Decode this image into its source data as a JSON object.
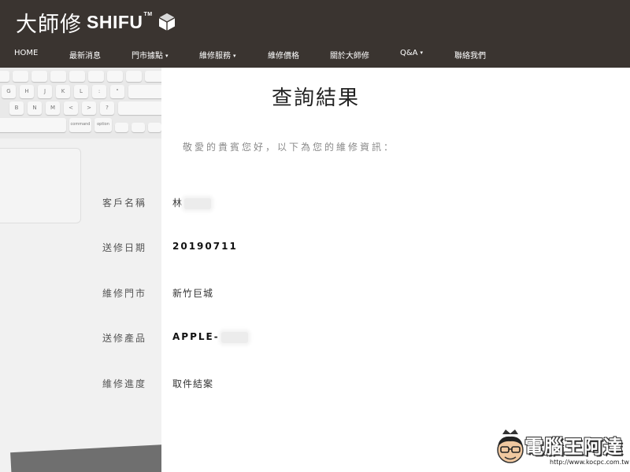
{
  "header": {
    "logo_cn": "大師修",
    "logo_en": "SHIFU",
    "logo_tm": "TM"
  },
  "nav": {
    "items": [
      {
        "label": "HOME",
        "dropdown": false
      },
      {
        "label": "最新消息",
        "dropdown": false
      },
      {
        "label": "門市據點",
        "dropdown": true
      },
      {
        "label": "維修服務",
        "dropdown": true
      },
      {
        "label": "維修價格",
        "dropdown": false
      },
      {
        "label": "關於大師修",
        "dropdown": false
      },
      {
        "label": "Q&A",
        "dropdown": true
      },
      {
        "label": "聯絡我們",
        "dropdown": false
      }
    ],
    "caret": "▾"
  },
  "keyboard": {
    "row1": [
      "G",
      "H",
      "J",
      "K",
      "L",
      ":",
      "\""
    ],
    "row2": [
      "B",
      "N",
      "M",
      "<",
      ">",
      "?"
    ],
    "row3": [
      "command",
      "option"
    ]
  },
  "main": {
    "title": "查詢結果",
    "greeting": "敬愛的貴賓您好，以下為您的維修資訊：",
    "rows": [
      {
        "label": "客戶名稱",
        "value": "林"
      },
      {
        "label": "送修日期",
        "value": "20190711"
      },
      {
        "label": "維修門市",
        "value": "新竹巨城"
      },
      {
        "label": "送修產品",
        "value": "APPLE-"
      },
      {
        "label": "維修進度",
        "value": "取件結案"
      }
    ]
  },
  "watermark": {
    "text": "電腦王阿達",
    "url": "http://www.kocpc.com.tw"
  },
  "colors": {
    "header_bg": "#3a3430",
    "nav_text": "#ffffff"
  }
}
